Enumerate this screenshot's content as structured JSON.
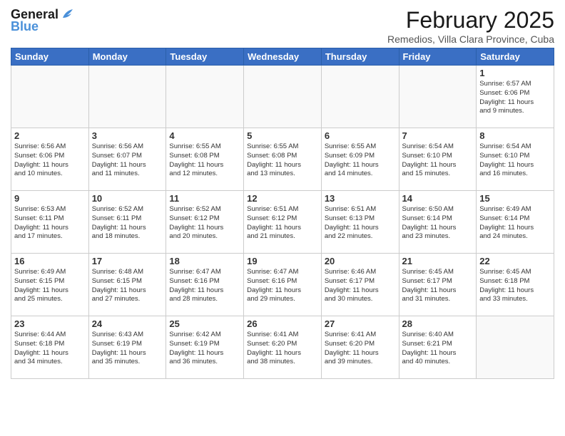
{
  "header": {
    "logo_line1": "General",
    "logo_line2": "Blue",
    "month": "February 2025",
    "location": "Remedios, Villa Clara Province, Cuba"
  },
  "weekdays": [
    "Sunday",
    "Monday",
    "Tuesday",
    "Wednesday",
    "Thursday",
    "Friday",
    "Saturday"
  ],
  "weeks": [
    [
      {
        "day": "",
        "info": ""
      },
      {
        "day": "",
        "info": ""
      },
      {
        "day": "",
        "info": ""
      },
      {
        "day": "",
        "info": ""
      },
      {
        "day": "",
        "info": ""
      },
      {
        "day": "",
        "info": ""
      },
      {
        "day": "1",
        "info": "Sunrise: 6:57 AM\nSunset: 6:06 PM\nDaylight: 11 hours\nand 9 minutes."
      }
    ],
    [
      {
        "day": "2",
        "info": "Sunrise: 6:56 AM\nSunset: 6:06 PM\nDaylight: 11 hours\nand 10 minutes."
      },
      {
        "day": "3",
        "info": "Sunrise: 6:56 AM\nSunset: 6:07 PM\nDaylight: 11 hours\nand 11 minutes."
      },
      {
        "day": "4",
        "info": "Sunrise: 6:55 AM\nSunset: 6:08 PM\nDaylight: 11 hours\nand 12 minutes."
      },
      {
        "day": "5",
        "info": "Sunrise: 6:55 AM\nSunset: 6:08 PM\nDaylight: 11 hours\nand 13 minutes."
      },
      {
        "day": "6",
        "info": "Sunrise: 6:55 AM\nSunset: 6:09 PM\nDaylight: 11 hours\nand 14 minutes."
      },
      {
        "day": "7",
        "info": "Sunrise: 6:54 AM\nSunset: 6:10 PM\nDaylight: 11 hours\nand 15 minutes."
      },
      {
        "day": "8",
        "info": "Sunrise: 6:54 AM\nSunset: 6:10 PM\nDaylight: 11 hours\nand 16 minutes."
      }
    ],
    [
      {
        "day": "9",
        "info": "Sunrise: 6:53 AM\nSunset: 6:11 PM\nDaylight: 11 hours\nand 17 minutes."
      },
      {
        "day": "10",
        "info": "Sunrise: 6:52 AM\nSunset: 6:11 PM\nDaylight: 11 hours\nand 18 minutes."
      },
      {
        "day": "11",
        "info": "Sunrise: 6:52 AM\nSunset: 6:12 PM\nDaylight: 11 hours\nand 20 minutes."
      },
      {
        "day": "12",
        "info": "Sunrise: 6:51 AM\nSunset: 6:12 PM\nDaylight: 11 hours\nand 21 minutes."
      },
      {
        "day": "13",
        "info": "Sunrise: 6:51 AM\nSunset: 6:13 PM\nDaylight: 11 hours\nand 22 minutes."
      },
      {
        "day": "14",
        "info": "Sunrise: 6:50 AM\nSunset: 6:14 PM\nDaylight: 11 hours\nand 23 minutes."
      },
      {
        "day": "15",
        "info": "Sunrise: 6:49 AM\nSunset: 6:14 PM\nDaylight: 11 hours\nand 24 minutes."
      }
    ],
    [
      {
        "day": "16",
        "info": "Sunrise: 6:49 AM\nSunset: 6:15 PM\nDaylight: 11 hours\nand 25 minutes."
      },
      {
        "day": "17",
        "info": "Sunrise: 6:48 AM\nSunset: 6:15 PM\nDaylight: 11 hours\nand 27 minutes."
      },
      {
        "day": "18",
        "info": "Sunrise: 6:47 AM\nSunset: 6:16 PM\nDaylight: 11 hours\nand 28 minutes."
      },
      {
        "day": "19",
        "info": "Sunrise: 6:47 AM\nSunset: 6:16 PM\nDaylight: 11 hours\nand 29 minutes."
      },
      {
        "day": "20",
        "info": "Sunrise: 6:46 AM\nSunset: 6:17 PM\nDaylight: 11 hours\nand 30 minutes."
      },
      {
        "day": "21",
        "info": "Sunrise: 6:45 AM\nSunset: 6:17 PM\nDaylight: 11 hours\nand 31 minutes."
      },
      {
        "day": "22",
        "info": "Sunrise: 6:45 AM\nSunset: 6:18 PM\nDaylight: 11 hours\nand 33 minutes."
      }
    ],
    [
      {
        "day": "23",
        "info": "Sunrise: 6:44 AM\nSunset: 6:18 PM\nDaylight: 11 hours\nand 34 minutes."
      },
      {
        "day": "24",
        "info": "Sunrise: 6:43 AM\nSunset: 6:19 PM\nDaylight: 11 hours\nand 35 minutes."
      },
      {
        "day": "25",
        "info": "Sunrise: 6:42 AM\nSunset: 6:19 PM\nDaylight: 11 hours\nand 36 minutes."
      },
      {
        "day": "26",
        "info": "Sunrise: 6:41 AM\nSunset: 6:20 PM\nDaylight: 11 hours\nand 38 minutes."
      },
      {
        "day": "27",
        "info": "Sunrise: 6:41 AM\nSunset: 6:20 PM\nDaylight: 11 hours\nand 39 minutes."
      },
      {
        "day": "28",
        "info": "Sunrise: 6:40 AM\nSunset: 6:21 PM\nDaylight: 11 hours\nand 40 minutes."
      },
      {
        "day": "",
        "info": ""
      }
    ]
  ]
}
